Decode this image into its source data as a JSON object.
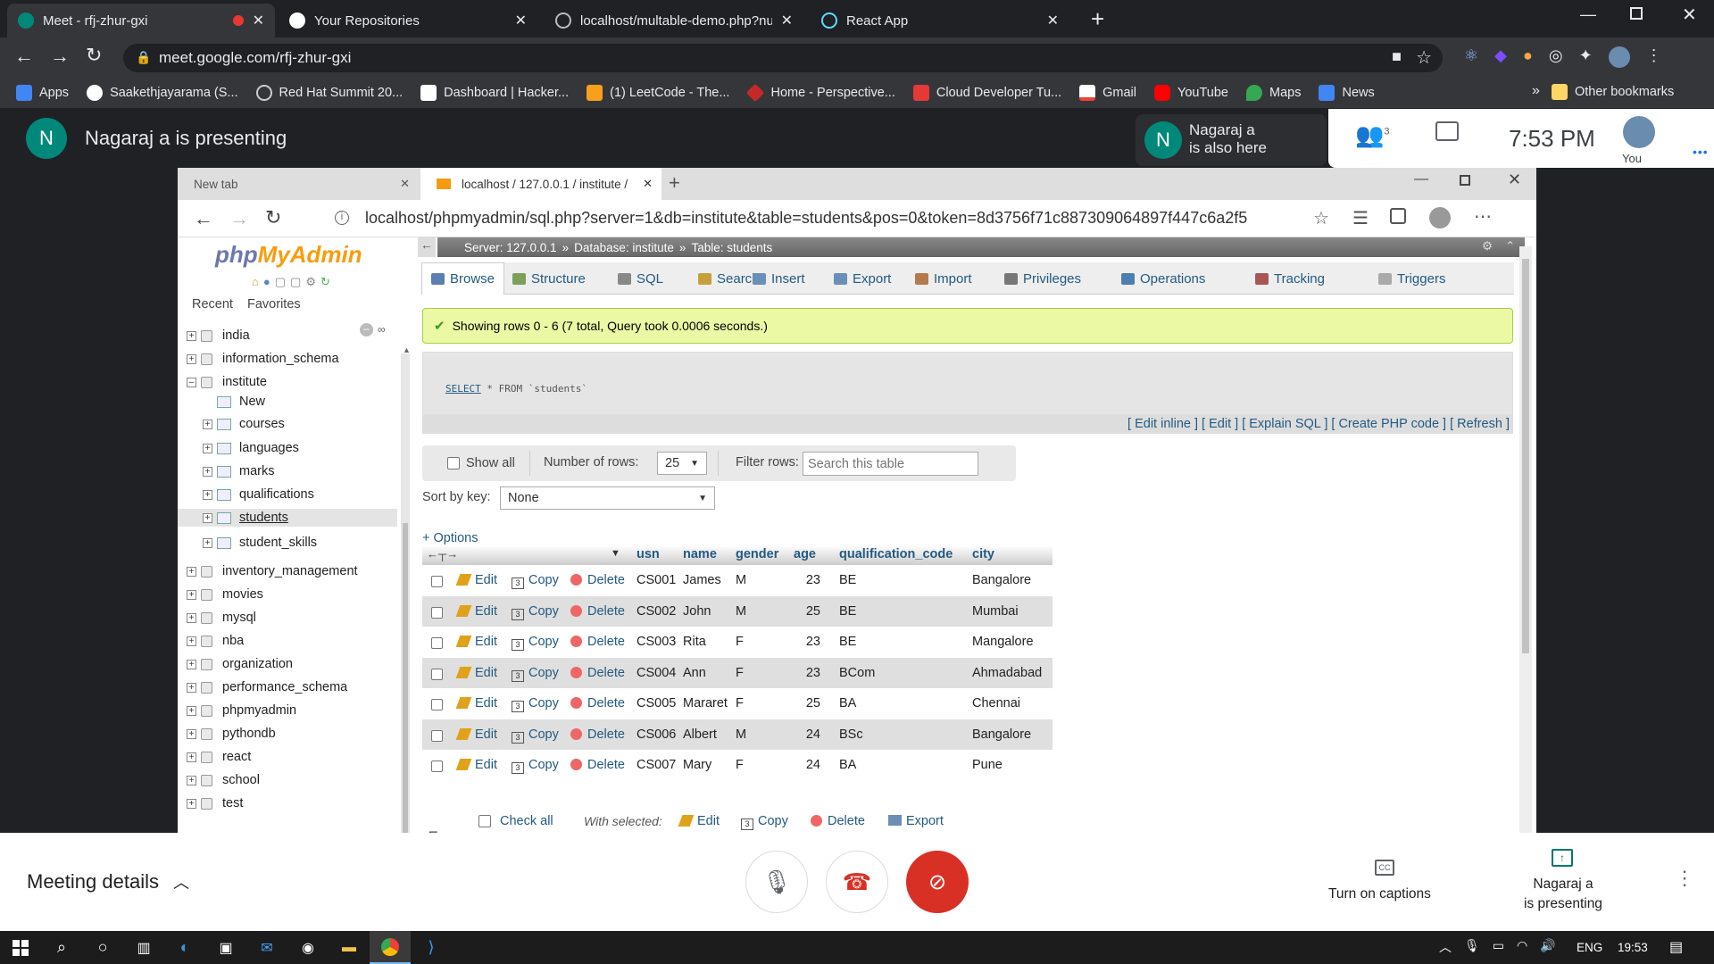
{
  "outer_browser": {
    "tabs": [
      {
        "title": "Meet - rfj-zhur-gxi",
        "active": true
      },
      {
        "title": "Your Repositories",
        "active": false
      },
      {
        "title": "localhost/multable-demo.php?nu",
        "active": false
      },
      {
        "title": "React App",
        "active": false
      }
    ],
    "url": "meet.google.com/rfj-zhur-gxi",
    "bookmarks": [
      "Apps",
      "Saakethjayarama (S...",
      "Red Hat Summit 20...",
      "Dashboard | Hacker...",
      "(1) LeetCode - The...",
      "Home - Perspective...",
      "Cloud Developer Tu...",
      "Gmail",
      "YouTube",
      "Maps",
      "News"
    ],
    "other_bookmarks": "Other bookmarks",
    "overflow": "»"
  },
  "meet": {
    "presenter_initial": "N",
    "presenting_text": "Nagaraj a is presenting",
    "also_here_line1": "Nagaraj a",
    "also_here_line2": "is also here",
    "participants_count": "3",
    "time": "7:53 PM",
    "you_label": "You",
    "meeting_details": "Meeting details",
    "captions_label": "Turn on captions",
    "presenting_line1": "Nagaraj a",
    "presenting_line2": "is presenting"
  },
  "inner_browser": {
    "tabs": [
      {
        "title": "New tab"
      },
      {
        "title": "localhost / 127.0.0.1 / institute /"
      }
    ],
    "url": "localhost/phpmyadmin/sql.php?server=1&db=institute&table=students&pos=0&token=8d3756f71c887309064897f447c6a2f5"
  },
  "pma": {
    "logo_php": "php",
    "logo_rest": "MyAdmin",
    "recent": "Recent",
    "favorites": "Favorites",
    "tree": [
      {
        "label": "india",
        "level": 0
      },
      {
        "label": "information_schema",
        "level": 0
      },
      {
        "label": "institute",
        "level": 0,
        "expanded": true
      },
      {
        "label": "New",
        "level": 1,
        "is_new": true
      },
      {
        "label": "courses",
        "level": 1
      },
      {
        "label": "languages",
        "level": 1
      },
      {
        "label": "marks",
        "level": 1
      },
      {
        "label": "qualifications",
        "level": 1
      },
      {
        "label": "students",
        "level": 1,
        "selected": true
      },
      {
        "label": "student_skills",
        "level": 1
      },
      {
        "label": "inventory_management",
        "level": 0
      },
      {
        "label": "movies",
        "level": 0
      },
      {
        "label": "mysql",
        "level": 0
      },
      {
        "label": "nba",
        "level": 0
      },
      {
        "label": "organization",
        "level": 0
      },
      {
        "label": "performance_schema",
        "level": 0
      },
      {
        "label": "phpmyadmin",
        "level": 0
      },
      {
        "label": "pythondb",
        "level": 0
      },
      {
        "label": "react",
        "level": 0
      },
      {
        "label": "school",
        "level": 0
      },
      {
        "label": "test",
        "level": 0
      }
    ],
    "breadcrumb": {
      "server": "Server: 127.0.0.1",
      "database": "Database: institute",
      "table": "Table: students",
      "sep": "»"
    },
    "tabs": [
      "Browse",
      "Structure",
      "SQL",
      "Search",
      "Insert",
      "Export",
      "Import",
      "Privileges",
      "Operations",
      "Tracking",
      "Triggers"
    ],
    "success_message": "Showing rows 0 - 6 (7 total, Query took 0.0006 seconds.)",
    "sql_keyword": "SELECT",
    "sql_rest": "* FROM `students`",
    "sql_links": "[ Edit inline ] [ Edit ] [ Explain SQL ] [ Create PHP code ] [ Refresh ]",
    "show_all": "Show all",
    "number_of_rows_label": "Number of rows:",
    "number_of_rows_value": "25",
    "filter_label": "Filter rows:",
    "filter_placeholder": "Search this table",
    "sort_label": "Sort by key:",
    "sort_value": "None",
    "options_link": "+ Options",
    "columns": [
      "usn",
      "name",
      "gender",
      "age",
      "qualification_code",
      "city"
    ],
    "action_labels": {
      "edit": "Edit",
      "copy": "Copy",
      "delete": "Delete"
    },
    "rows": [
      [
        "CS001",
        "James",
        "M",
        "23",
        "BE",
        "Bangalore"
      ],
      [
        "CS002",
        "John",
        "M",
        "25",
        "BE",
        "Mumbai"
      ],
      [
        "CS003",
        "Rita",
        "F",
        "23",
        "BE",
        "Mangalore"
      ],
      [
        "CS004",
        "Ann",
        "F",
        "23",
        "BCom",
        "Ahmadabad"
      ],
      [
        "CS005",
        "Mararet",
        "F",
        "25",
        "BA",
        "Chennai"
      ],
      [
        "CS006",
        "Albert",
        "M",
        "24",
        "BSc",
        "Bangalore"
      ],
      [
        "CS007",
        "Mary",
        "F",
        "24",
        "BA",
        "Pune"
      ]
    ],
    "check_all": "Check all",
    "with_selected": "With selected:",
    "bulk_actions": [
      "Edit",
      "Copy",
      "Delete",
      "Export"
    ]
  },
  "taskbar": {
    "lang": "ENG",
    "time": "19:53"
  },
  "colors": {
    "meet_bg": "#202124",
    "pma_link": "#235a81",
    "end_call": "#d93025",
    "success_bg": "#ebf8a4"
  }
}
